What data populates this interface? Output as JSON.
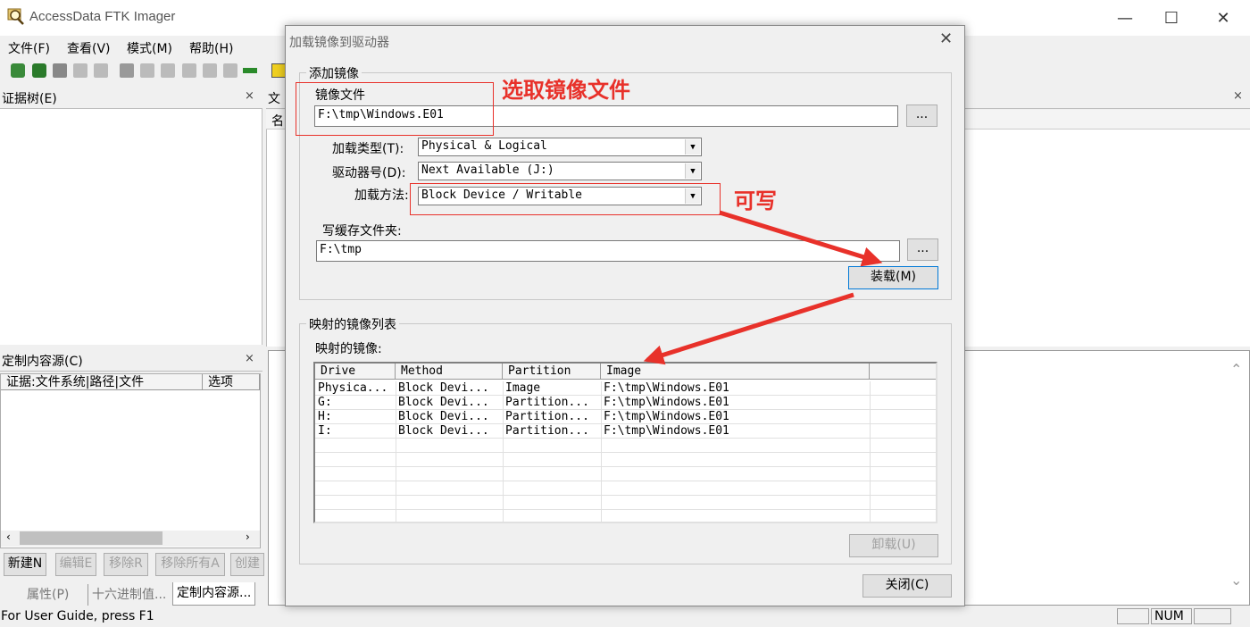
{
  "window": {
    "title": "AccessData FTK Imager",
    "minimize": "—",
    "maximize": "☐",
    "close": "✕"
  },
  "menu": [
    "文件(F)",
    "查看(V)",
    "模式(M)",
    "帮助(H)"
  ],
  "evidence_tree": {
    "title": "证据树(E)",
    "close": "×"
  },
  "file_list": {
    "title_fragment": "文",
    "col_fragment": "名",
    "close": "×"
  },
  "custom_source": {
    "title": "定制内容源(C)",
    "close": "×",
    "col_evidence": "证据:文件系统|路径|文件",
    "col_options": "选项",
    "buttons": [
      "新建N",
      "编辑E",
      "移除R",
      "移除所有A",
      "创建"
    ]
  },
  "bottom_tabs": [
    "属性(P)",
    "十六进制值...",
    "定制内容源..."
  ],
  "status": {
    "text": "For User Guide, press F1",
    "num": "NUM"
  },
  "dialog": {
    "title": "加载镜像到驱动器",
    "close": "✕",
    "add_group": "添加镜像",
    "image_file_label": "镜像文件",
    "image_file_value": "F:\\tmp\\Windows.E01",
    "browse1": "...",
    "mount_type_label": "加载类型(T):",
    "mount_type_value": "Physical & Logical",
    "drive_letter_label": "驱动器号(D):",
    "drive_letter_value": "Next Available (J:)",
    "mount_method_label": "加载方法:",
    "mount_method_value": "Block Device / Writable",
    "cache_folder_label": "写缓存文件夹:",
    "cache_folder_value": "F:\\tmp",
    "browse2": "...",
    "mount_button": "装载(M)",
    "mapped_group": "映射的镜像列表",
    "mapped_label": "映射的镜像:",
    "columns": [
      "Drive",
      "Method",
      "Partition",
      "Image"
    ],
    "rows": [
      [
        "Physica...",
        "Block Devi...",
        "Image",
        "F:\\tmp\\Windows.E01"
      ],
      [
        "G:",
        "Block Devi...",
        "Partition...",
        "F:\\tmp\\Windows.E01"
      ],
      [
        "H:",
        "Block Devi...",
        "Partition...",
        "F:\\tmp\\Windows.E01"
      ],
      [
        "I:",
        "Block Devi...",
        "Partition...",
        "F:\\tmp\\Windows.E01"
      ]
    ],
    "unmount_button": "卸载(U)",
    "close_button": "关闭(C)"
  },
  "annotations": {
    "select_image": "选取镜像文件",
    "writable": "可写",
    "color": "#e8312a"
  }
}
